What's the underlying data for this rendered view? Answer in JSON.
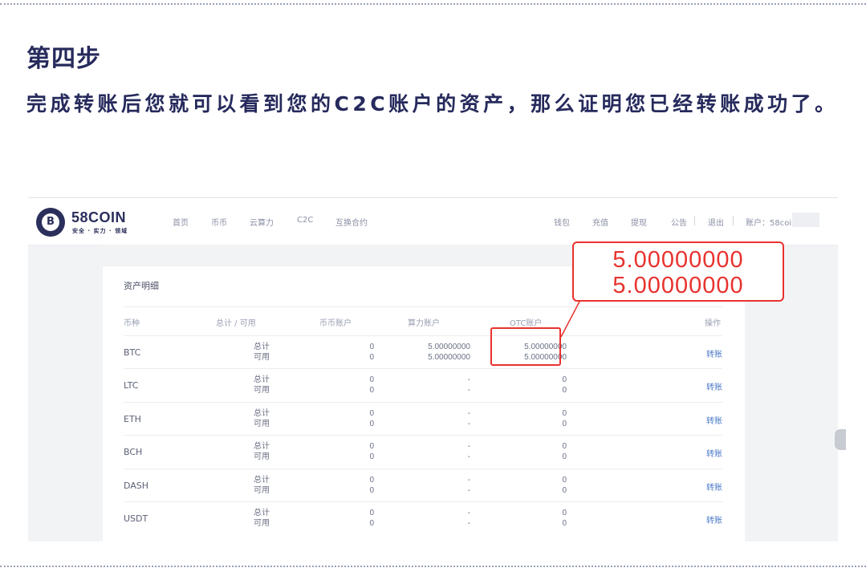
{
  "heading": "第四步",
  "description": "完成转账后您就可以看到您的C2C账户的资产，那么证明您已经转账成功了。",
  "site": {
    "logo_mark": "B",
    "logo_name": "58COIN",
    "logo_sub": "安全 · 实力 · 领域",
    "nav_left": [
      "首页",
      "币币",
      "云算力",
      "C2C",
      "互换合约"
    ],
    "nav_right": [
      "钱包",
      "充值",
      "提现",
      "公告",
      "退出"
    ],
    "account_label": "账户：58coin"
  },
  "assets": {
    "title": "资产明细",
    "headers": [
      "币种",
      "总计 / 可用",
      "币币账户",
      "算力账户",
      "OTC账户",
      "操作"
    ],
    "total_label": "总计",
    "available_label": "可用",
    "action_label": "转账",
    "rows": [
      {
        "coin": "BTC",
        "spot": [
          "0",
          "0"
        ],
        "hash": [
          "5.00000000",
          "5.00000000"
        ],
        "otc": [
          "5.00000000",
          "5.00000000"
        ]
      },
      {
        "coin": "LTC",
        "spot": [
          "0",
          "0"
        ],
        "hash": [
          "-",
          "-"
        ],
        "otc": [
          "0",
          "0"
        ]
      },
      {
        "coin": "ETH",
        "spot": [
          "0",
          "0"
        ],
        "hash": [
          "-",
          "-"
        ],
        "otc": [
          "0",
          "0"
        ]
      },
      {
        "coin": "BCH",
        "spot": [
          "0",
          "0"
        ],
        "hash": [
          "-",
          "-"
        ],
        "otc": [
          "0",
          "0"
        ]
      },
      {
        "coin": "DASH",
        "spot": [
          "0",
          "0"
        ],
        "hash": [
          "-",
          "-"
        ],
        "otc": [
          "0",
          "0"
        ]
      },
      {
        "coin": "USDT",
        "spot": [
          "0",
          "0"
        ],
        "hash": [
          "-",
          "-"
        ],
        "otc": [
          "0",
          "0"
        ]
      }
    ]
  },
  "callout": {
    "line1": "5.00000000",
    "line2": "5.00000000"
  },
  "colors": {
    "heading": "#262a5c",
    "highlight": "#e8322e",
    "link": "#4a7ac8"
  }
}
